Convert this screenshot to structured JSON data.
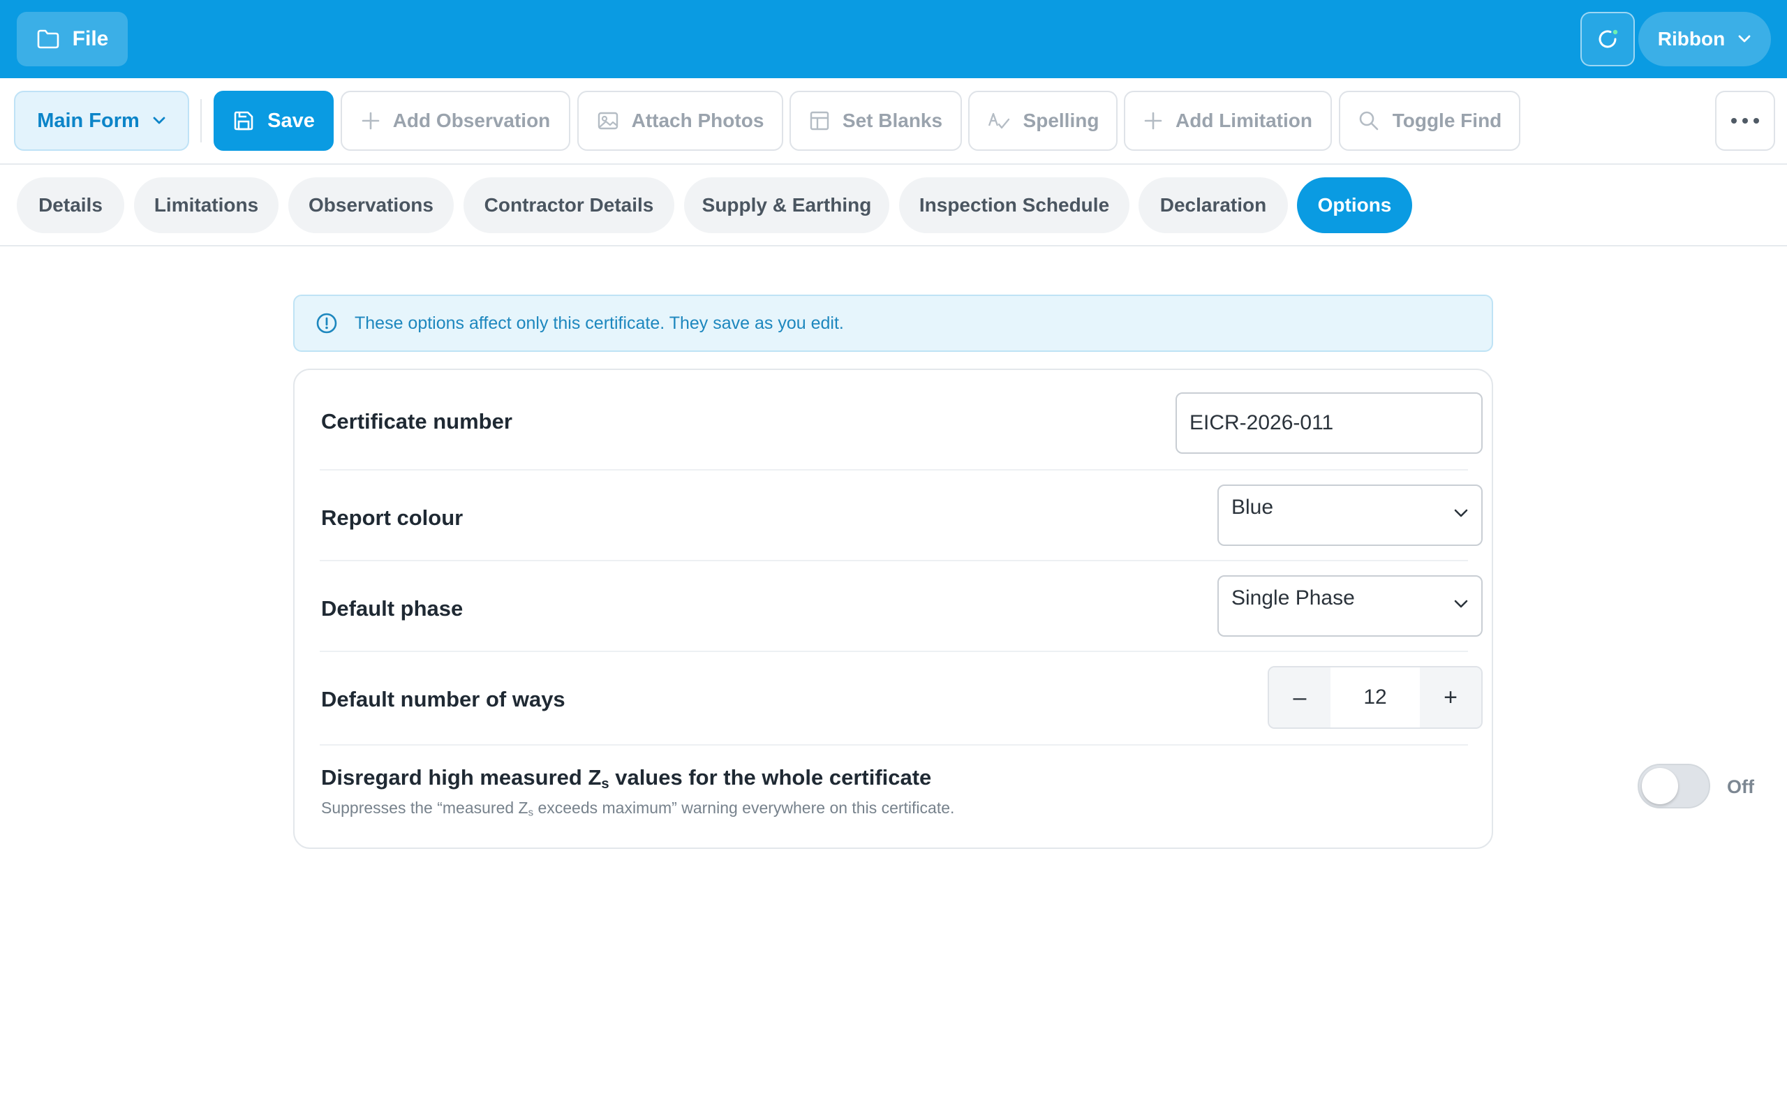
{
  "topbar": {
    "file_label": "File",
    "ribbon_label": "Ribbon"
  },
  "toolbar": {
    "form_selector": "Main Form",
    "save": "Save",
    "add_observation": "Add Observation",
    "attach_photos": "Attach Photos",
    "set_blanks": "Set Blanks",
    "spelling": "Spelling",
    "add_limitation": "Add Limitation",
    "toggle_find": "Toggle Find"
  },
  "tabs": [
    {
      "label": "Details",
      "active": false
    },
    {
      "label": "Limitations",
      "active": false
    },
    {
      "label": "Observations",
      "active": false
    },
    {
      "label": "Contractor Details",
      "active": false
    },
    {
      "label": "Supply & Earthing",
      "active": false
    },
    {
      "label": "Inspection Schedule",
      "active": false
    },
    {
      "label": "Declaration",
      "active": false
    },
    {
      "label": "Options",
      "active": true
    }
  ],
  "info_banner": "These options affect only this certificate. They save as you edit.",
  "options": {
    "certificate_number": {
      "label": "Certificate number",
      "value": "EICR-2026-011"
    },
    "report_colour": {
      "label": "Report colour",
      "value": "Blue"
    },
    "default_phase": {
      "label": "Default phase",
      "value": "Single Phase"
    },
    "default_ways": {
      "label": "Default number of ways",
      "value": "12",
      "decrement": "–",
      "increment": "+"
    },
    "disregard_zs": {
      "label_pre": "Disregard high measured Z",
      "label_sub": "s",
      "label_post": " values for the whole certificate",
      "help_pre": "Suppresses the “measured Z",
      "help_sub": "s",
      "help_post": " exceeds maximum” warning everywhere on this certificate.",
      "state": "Off"
    }
  },
  "colors": {
    "accent": "#0a9be2",
    "banner_bg": "#e6f5fc",
    "banner_text": "#1d87be"
  }
}
